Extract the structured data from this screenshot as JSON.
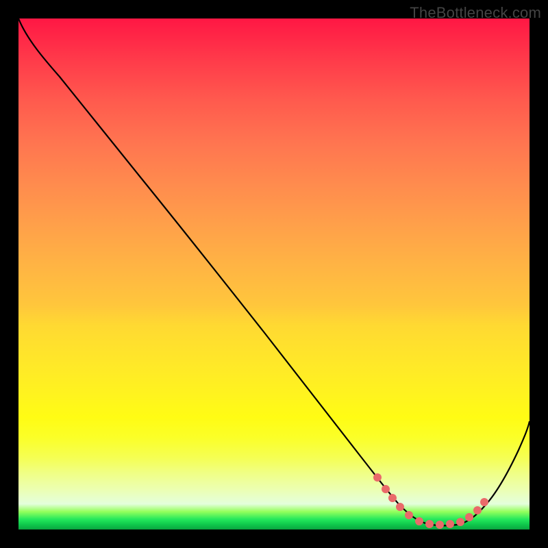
{
  "watermark": "TheBottleneck.com",
  "chart_data": {
    "type": "line",
    "title": "",
    "xlabel": "",
    "ylabel": "",
    "xlim": [
      0,
      100
    ],
    "ylim": [
      0,
      100
    ],
    "series": [
      {
        "name": "black-curve",
        "x": [
          0,
          4,
          10,
          14,
          20,
          26,
          32,
          38,
          44,
          50,
          56,
          62,
          66,
          70,
          72,
          74,
          78,
          82,
          86,
          88,
          92,
          96,
          100
        ],
        "y": [
          100,
          97,
          91,
          86.5,
          79,
          71,
          63,
          55,
          47,
          39,
          31,
          23,
          17,
          11.5,
          8.5,
          6,
          2.8,
          1.4,
          1.2,
          1.5,
          4.5,
          12,
          22
        ]
      },
      {
        "name": "red-dots",
        "x": [
          70,
          72,
          73.5,
          75,
          77,
          79,
          81,
          83,
          85,
          86.5,
          88,
          89.5,
          91
        ],
        "y": [
          11.5,
          8.5,
          6.5,
          5,
          3,
          1.8,
          1.3,
          1.2,
          1.3,
          1.6,
          2.5,
          4,
          6
        ]
      }
    ],
    "gradient_note": "vertical rainbow red-to-green background"
  }
}
